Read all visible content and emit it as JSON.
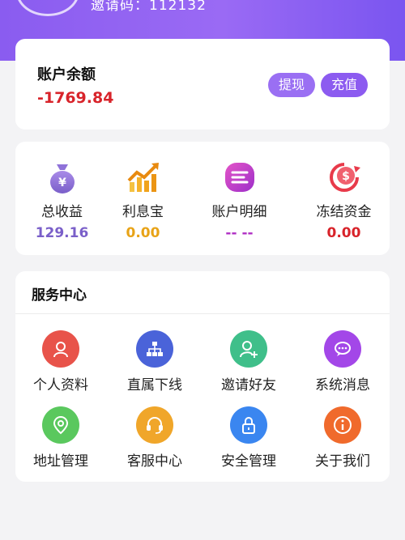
{
  "header": {
    "invite_text": "邀请码：112132"
  },
  "balance": {
    "label": "账户余额",
    "value": "-1769.84",
    "withdraw_label": "提现",
    "recharge_label": "充值"
  },
  "stats": [
    {
      "label": "总收益",
      "value": "129.16",
      "icon": "money-bag-icon",
      "color": "#7a5fc9"
    },
    {
      "label": "利息宝",
      "value": "0.00",
      "icon": "trend-up-icon",
      "color": "#e8a317"
    },
    {
      "label": "账户明细",
      "value": "-- --",
      "icon": "account-detail-icon",
      "color": "#b02fc4"
    },
    {
      "label": "冻结资金",
      "value": "0.00",
      "icon": "frozen-funds-icon",
      "color": "#d8232a"
    }
  ],
  "services": {
    "title": "服务中心",
    "items": [
      {
        "label": "个人资料",
        "icon": "user-icon",
        "color": "#e8534a"
      },
      {
        "label": "直属下线",
        "icon": "hierarchy-icon",
        "color": "#4a63d9"
      },
      {
        "label": "邀请好友",
        "icon": "add-user-icon",
        "color": "#3fbf8a"
      },
      {
        "label": "系统消息",
        "icon": "message-icon",
        "color": "#a347e8"
      },
      {
        "label": "地址管理",
        "icon": "location-icon",
        "color": "#5ac85e"
      },
      {
        "label": "客服中心",
        "icon": "headset-icon",
        "color": "#f0a62a"
      },
      {
        "label": "安全管理",
        "icon": "lock-icon",
        "color": "#3a86f0"
      },
      {
        "label": "关于我们",
        "icon": "info-icon",
        "color": "#f06a2c"
      }
    ]
  }
}
